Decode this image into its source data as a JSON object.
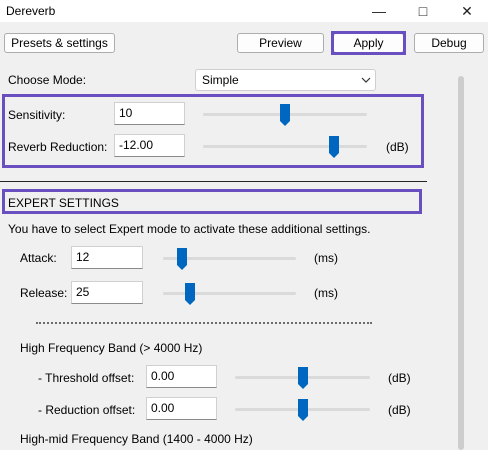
{
  "window": {
    "title": "Dereverb"
  },
  "toolbar": {
    "presets_label": "Presets & settings",
    "preview_label": "Preview",
    "apply_label": "Apply",
    "debug_label": "Debug"
  },
  "mode": {
    "label": "Choose Mode:",
    "value": "Simple"
  },
  "basic": {
    "sensitivity": {
      "label": "Sensitivity:",
      "value": "10",
      "slider_fraction": 0.5
    },
    "reverb_reduction": {
      "label": "Reverb Reduction:",
      "value": "-12.00",
      "unit": "(dB)",
      "slider_fraction": 0.8
    }
  },
  "expert": {
    "header": "EXPERT SETTINGS",
    "note": "You have to select Expert mode to activate these additional settings.",
    "attack": {
      "label": "Attack:",
      "value": "12",
      "unit": "(ms)",
      "slider_fraction": 0.14
    },
    "release": {
      "label": "Release:",
      "value": "25",
      "unit": "(ms)",
      "slider_fraction": 0.2
    },
    "high_band": {
      "label": "High Frequency Band (> 4000 Hz)",
      "threshold": {
        "label": "- Threshold offset:",
        "value": "0.00",
        "unit": "(dB)",
        "slider_fraction": 0.5
      },
      "reduction": {
        "label": "- Reduction offset:",
        "value": "0.00",
        "unit": "(dB)",
        "slider_fraction": 0.5
      }
    },
    "high_mid_band": {
      "label": "High-mid Frequency Band (1400 - 4000 Hz)"
    }
  },
  "colors": {
    "highlight": "#6a4fc1",
    "accent": "#0067c0"
  },
  "icons": {
    "minimize": "minimize-icon",
    "maximize": "maximize-icon",
    "close": "close-icon",
    "dropdown": "chevron-down-icon"
  }
}
